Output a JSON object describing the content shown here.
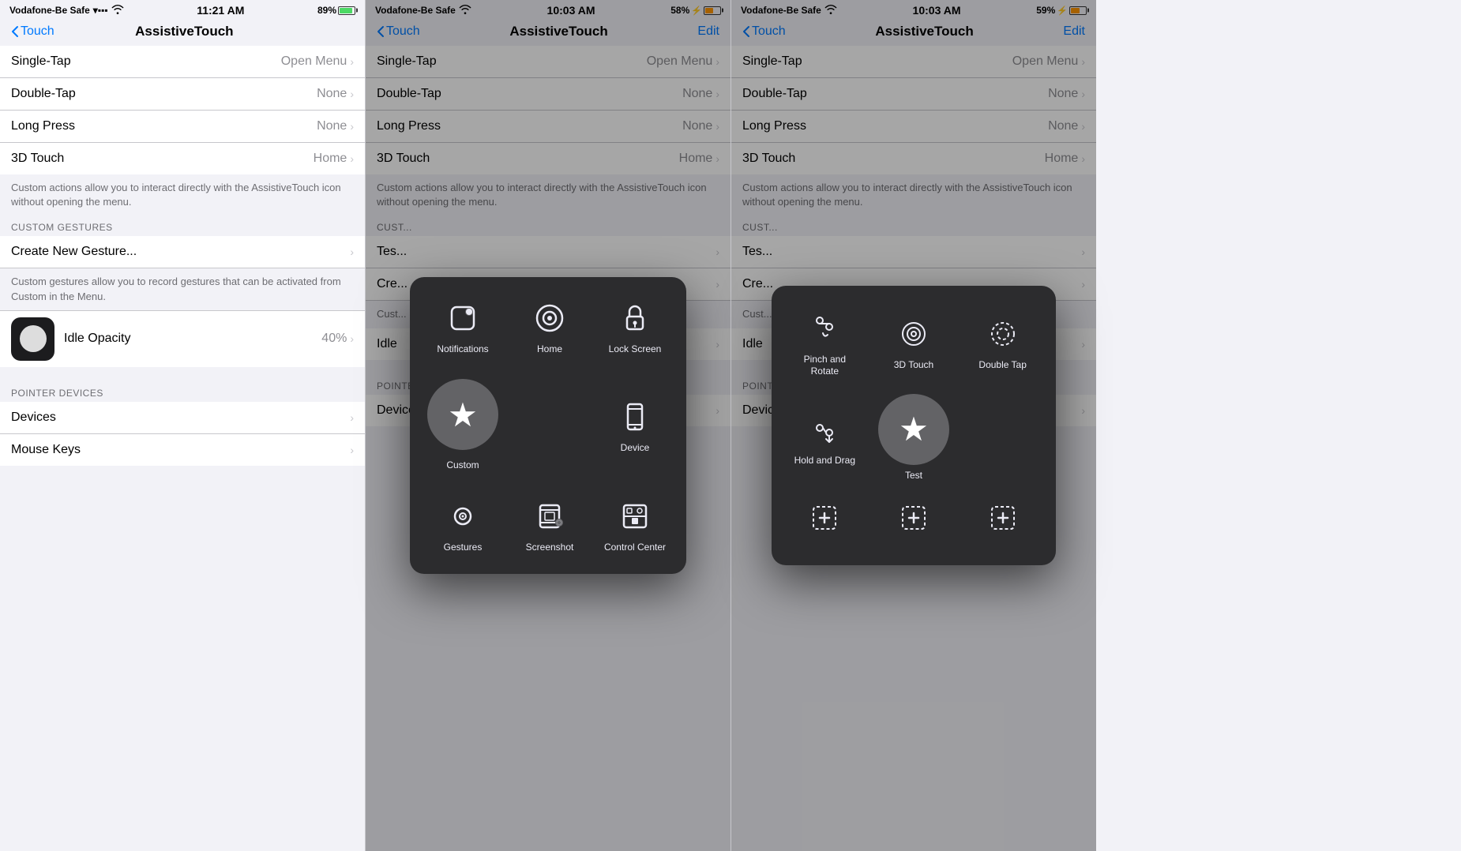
{
  "panels": [
    {
      "id": "panel1",
      "statusBar": {
        "carrier": "Vodafone-Be Safe",
        "wifi": true,
        "time": "11:21 AM",
        "battery": "89%",
        "batteryLevel": 89,
        "charging": false
      },
      "navBar": {
        "backLabel": "Touch",
        "title": "AssistiveTouch",
        "editLabel": null
      },
      "rows": [
        {
          "label": "Single-Tap",
          "value": "Open Menu"
        },
        {
          "label": "Double-Tap",
          "value": "None"
        },
        {
          "label": "Long Press",
          "value": "None"
        },
        {
          "label": "3D Touch",
          "value": "Home"
        }
      ],
      "description": "Custom actions allow you to interact directly with the AssistiveTouch icon without opening the menu.",
      "customGesturesLabel": "CUSTOM GESTURES",
      "createGesture": "Create New Gesture...",
      "gestureDescription": "Custom gestures allow you to record gestures that can be activated from Custom in the Menu.",
      "opacityLabel": "Idle Opacity",
      "opacityValue": "40%",
      "pointerLabel": "POINTER DEVICES",
      "pointerRows": [
        {
          "label": "Devices",
          "value": ""
        },
        {
          "label": "Mouse Keys",
          "value": ""
        }
      ],
      "showPopup": false
    },
    {
      "id": "panel2",
      "statusBar": {
        "carrier": "Vodafone-Be Safe",
        "wifi": true,
        "time": "10:03 AM",
        "battery": "58%",
        "batteryLevel": 58,
        "charging": true
      },
      "navBar": {
        "backLabel": "Touch",
        "title": "AssistiveTouch",
        "editLabel": "Edit"
      },
      "rows": [
        {
          "label": "Single-Tap",
          "value": "Open Menu"
        },
        {
          "label": "Double-Tap",
          "value": "None"
        },
        {
          "label": "Long Press",
          "value": "None"
        },
        {
          "label": "3D Touch",
          "value": "Home"
        }
      ],
      "description": "Custom actions allow you to interact directly with the AssistiveTouch icon without opening the menu.",
      "customGesturesLabel": "CUSTOM GESTURES",
      "createGesture": "Create New Gesture...",
      "gestureDescription": "Custom gestures allow you to record gestures that can be activated from Custom in the Menu.",
      "opacityLabel": "Idle",
      "opacityValue": "",
      "pointerLabel": "POINTER DEVICES",
      "pointerRows": [
        {
          "label": "Devices",
          "value": ""
        }
      ],
      "showPopup": true,
      "popup": {
        "items": [
          {
            "id": "notifications",
            "label": "Notifications",
            "icon": "notifications"
          },
          {
            "id": "home",
            "label": "Home",
            "icon": "home"
          },
          {
            "id": "lock-screen",
            "label": "Lock Screen",
            "icon": "lock"
          },
          {
            "id": "custom",
            "label": "Custom",
            "icon": "star",
            "isCenter": true
          },
          {
            "id": "device",
            "label": "Device",
            "icon": "device"
          },
          {
            "id": "gestures",
            "label": "Gestures",
            "icon": "gestures"
          },
          {
            "id": "screenshot",
            "label": "Screenshot",
            "icon": "screenshot"
          },
          {
            "id": "control-center",
            "label": "Control Center",
            "icon": "control-center"
          }
        ]
      }
    },
    {
      "id": "panel3",
      "statusBar": {
        "carrier": "Vodafone-Be Safe",
        "wifi": true,
        "time": "10:03 AM",
        "battery": "59%",
        "batteryLevel": 59,
        "charging": true
      },
      "navBar": {
        "backLabel": "Touch",
        "title": "AssistiveTouch",
        "editLabel": "Edit"
      },
      "rows": [
        {
          "label": "Single-Tap",
          "value": "Open Menu"
        },
        {
          "label": "Double-Tap",
          "value": "None"
        },
        {
          "label": "Long Press",
          "value": "None"
        },
        {
          "label": "3D Touch",
          "value": "Home"
        }
      ],
      "description": "Custom actions allow you to interact directly with the AssistiveTouch icon without opening the menu.",
      "customGesturesLabel": "CUSTOM GESTURES",
      "createGesture": "Create New Gesture...",
      "gestureDescription": "Custom gestures allow you to record gestures that can be activated from Custom in the Menu.",
      "opacityLabel": "Idle",
      "opacityValue": "",
      "pointerLabel": "POINTER DEVICES",
      "pointerRows": [
        {
          "label": "Devices",
          "value": ""
        }
      ],
      "showPopup": true,
      "popup": {
        "items": [
          {
            "id": "pinch-rotate",
            "label": "Pinch and Rotate",
            "icon": "pinch"
          },
          {
            "id": "3d-touch",
            "label": "3D Touch",
            "icon": "3dtouch"
          },
          {
            "id": "double-tap",
            "label": "Double Tap",
            "icon": "doubletap"
          },
          {
            "id": "hold-drag",
            "label": "Hold and Drag",
            "icon": "holddrag"
          },
          {
            "id": "test",
            "label": "Test",
            "icon": "star",
            "isCenter": true
          },
          {
            "id": "add1",
            "label": "",
            "icon": "add"
          },
          {
            "id": "add2",
            "label": "",
            "icon": "add"
          },
          {
            "id": "add3",
            "label": "",
            "icon": "add"
          }
        ]
      }
    }
  ],
  "colors": {
    "accent": "#007aff",
    "background": "#f2f2f7",
    "cellBackground": "#ffffff",
    "textPrimary": "#000000",
    "textSecondary": "#8e8e93",
    "separator": "#c7c7cc",
    "popupBg": "#2c2c2e",
    "popupItemActive": "#636366"
  }
}
